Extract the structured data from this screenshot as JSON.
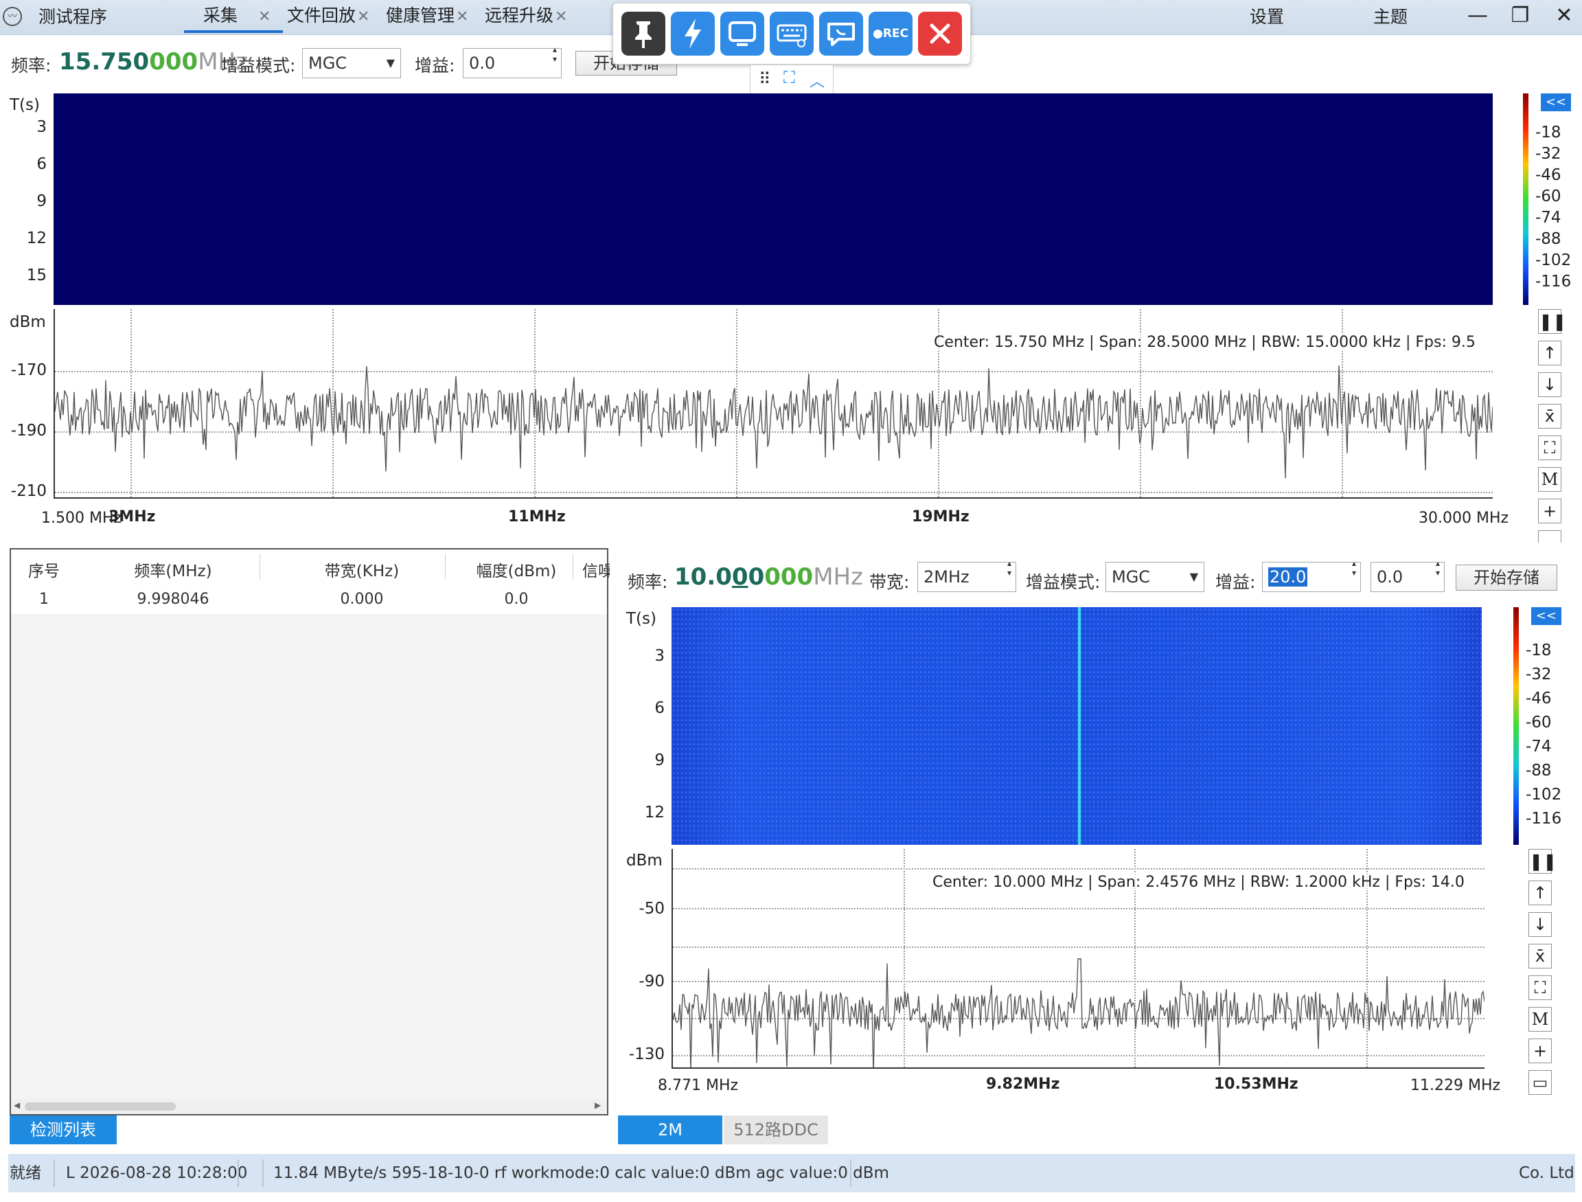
{
  "titlebar": {
    "app_title": "测试程序",
    "tabs": [
      {
        "label": "采集",
        "active": true
      },
      {
        "label": "文件回放",
        "active": false
      },
      {
        "label": "健康管理",
        "active": false
      },
      {
        "label": "远程升级",
        "active": false
      }
    ],
    "settings_label": "设置",
    "theme_label": "主题",
    "minimize": "—",
    "restore": "❐",
    "close": "✕"
  },
  "floatbar": {
    "buttons": [
      "pin-icon",
      "lightning-icon",
      "monitor-icon",
      "keyboard-icon",
      "chat-icon",
      "record-icon",
      "close-icon"
    ],
    "rec_label": "●REC",
    "colors": {
      "blue": "#2f8be6",
      "dark": "#3a3a3a",
      "red": "#e53b3b"
    }
  },
  "top": {
    "freq_label": "频率:",
    "freq_main": "15.750",
    "freq_mid": "000",
    "freq_unit": "MHz",
    "gain_mode_label": "增益模式:",
    "gain_mode_value": "MGC",
    "gain_label": "增益:",
    "gain_value": "0.0",
    "save_button": "开始存储",
    "waterfall": {
      "ylabel": "T(s)",
      "yticks": [
        "3",
        "6",
        "9",
        "12",
        "15"
      ],
      "color": "#000066"
    },
    "colorbar_ticks": [
      "-18",
      "-32",
      "-46",
      "-60",
      "-74",
      "-88",
      "-102",
      "-116"
    ],
    "collapse_label": "<<",
    "spectrum": {
      "ylabel": "dBm",
      "yticks": [
        "-170",
        "-190",
        "-210"
      ],
      "info": "Center: 15.750 MHz | Span: 28.5000 MHz | RBW: 15.0000 kHz | Fps: 9.5",
      "xtick_start": "1.500 MHz",
      "xtick_3": "3MHz",
      "xtick_11": "11MHz",
      "xtick_19": "19MHz",
      "xtick_end": "30.000 MHz"
    },
    "side_buttons": [
      "pause-icon",
      "arrow-up-icon",
      "arrow-down-icon",
      "x-bar-icon",
      "zoom-fit-icon",
      "marker-icon",
      "plus-icon",
      "ruler-icon"
    ]
  },
  "detection": {
    "columns": [
      "序号",
      "频率(MHz)",
      "带宽(KHz)",
      "幅度(dBm)",
      "信噪"
    ],
    "rows": [
      [
        "1",
        "9.998046",
        "0.000",
        "0.0"
      ]
    ],
    "tab_label": "检测列表"
  },
  "bottom": {
    "freq_label": "频率:",
    "freq_main": "10.0",
    "freq_cursor": "0",
    "freq_rest": "0",
    "freq_mid": "000",
    "freq_unit": "MHz",
    "bandwidth_label": "带宽:",
    "bandwidth_value": "2MHz",
    "gain_mode_label": "增益模式:",
    "gain_mode_value": "MGC",
    "gain_label": "增益:",
    "gain_value": "20.0",
    "gain_value2": "0.0",
    "save_button": "开始存储",
    "waterfall": {
      "ylabel": "T(s)",
      "yticks": [
        "3",
        "6",
        "9",
        "12"
      ],
      "color": "#1a4fe0"
    },
    "colorbar_ticks": [
      "-18",
      "-32",
      "-46",
      "-60",
      "-74",
      "-88",
      "-102",
      "-116"
    ],
    "collapse_label": "<<",
    "spectrum": {
      "ylabel": "dBm",
      "yticks": [
        "-50",
        "-90",
        "-130"
      ],
      "info": "Center: 10.000 MHz | Span: 2.4576 MHz | RBW: 1.2000 kHz | Fps: 14.0",
      "xticks": [
        "8.771 MHz",
        "9.82MHz",
        "10.53MHz",
        "11.229 MHz"
      ]
    },
    "tabs": [
      {
        "label": "2M",
        "active": true
      },
      {
        "label": "512路DDC",
        "active": false
      }
    ]
  },
  "status": {
    "ready": "就绪",
    "time": "L 2026-08-28 10:28:00",
    "info": "11.84 MByte/s 595-18-10-0 rf workmode:0 calc value:0 dBm agc value:0 dBm",
    "company": "Co. Ltd"
  }
}
